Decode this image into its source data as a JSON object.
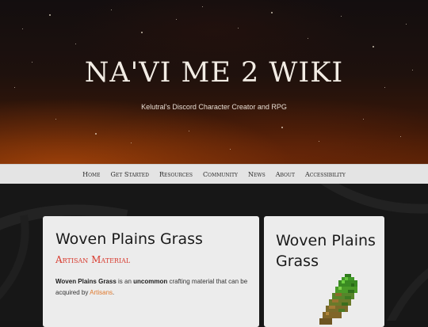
{
  "header": {
    "site_title": "NA'VI ME 2 WIKI",
    "tagline": "Kelutral's Discord Character Creator and RPG"
  },
  "nav": {
    "items": [
      "Home",
      "Get Started",
      "Resources",
      "Community",
      "News",
      "About",
      "Accessibility"
    ]
  },
  "article": {
    "title": "Woven Plains Grass",
    "type": "Artisan Material",
    "desc": {
      "name": "Woven Plains Grass",
      "part1": " is an ",
      "rarity": "uncommon",
      "part2": " crafting material that can be acquired by ",
      "link": "Artisans",
      "end": "."
    }
  },
  "sidebar": {
    "title": "Woven Plains Grass",
    "image_icon": "woven-plains-grass-icon"
  },
  "colors": {
    "type_label": "#d83a2e",
    "link": "#e07a2e",
    "nav_bg": "#e4e4e4",
    "card_bg": "#ececec"
  }
}
